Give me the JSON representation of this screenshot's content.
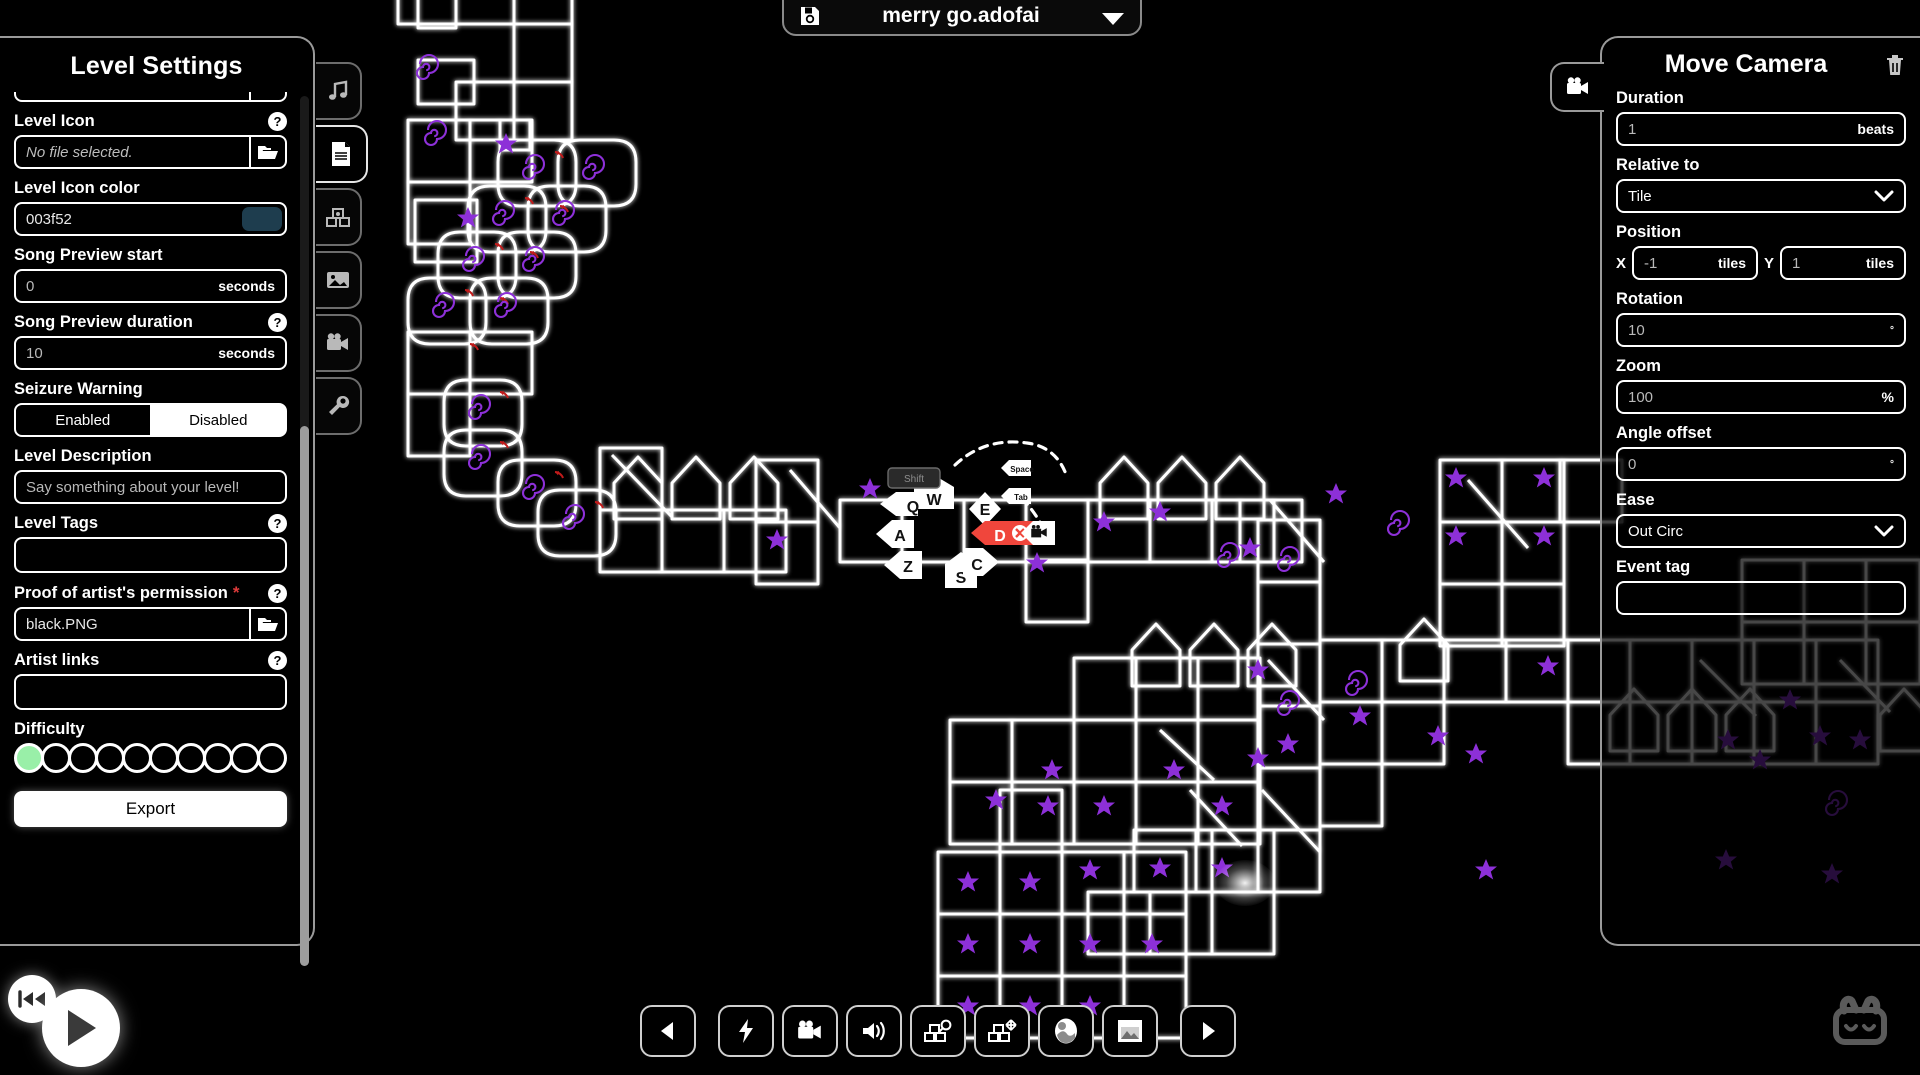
{
  "song_bar": {
    "save_icon": "floppy-disk-icon",
    "title": "merry go.adofai",
    "dropdown_icon": "chevron-down-icon"
  },
  "level_settings": {
    "title": "Level Settings",
    "fields": [
      {
        "label": "Level Icon",
        "help": "?",
        "value": "No file selected.",
        "placeholder": true,
        "control": "file",
        "icon": "folder-icon"
      },
      {
        "label": "Level Icon color",
        "value": "003f52",
        "control": "color",
        "swatch_hex": "#1e3d4e"
      },
      {
        "label": "Song Preview start",
        "value": "0",
        "unit": "seconds",
        "control": "number"
      },
      {
        "label": "Song Preview duration",
        "help": "?",
        "value": "10",
        "unit": "seconds",
        "control": "number"
      }
    ],
    "seizure_warning": {
      "label": "Seizure Warning",
      "options": [
        "Enabled",
        "Disabled"
      ],
      "selected": "Disabled"
    },
    "level_description": {
      "label": "Level Description",
      "placeholder": "Say something about your level!",
      "value": ""
    },
    "level_tags": {
      "label": "Level Tags",
      "help": "?",
      "value": ""
    },
    "proof": {
      "label": "Proof of artist's permission",
      "required_marker": "*",
      "help": "?",
      "value": "black.PNG",
      "icon": "folder-icon"
    },
    "artist_links": {
      "label": "Artist links",
      "help": "?",
      "value": ""
    },
    "difficulty": {
      "label": "Difficulty",
      "total": 10,
      "selected": 1,
      "fill_hex": "#99efa8"
    },
    "export_label": "Export"
  },
  "rail": {
    "items": [
      {
        "icon": "music-note-icon",
        "active": false
      },
      {
        "icon": "document-icon",
        "active": true
      },
      {
        "icon": "tiles-icon",
        "active": false
      },
      {
        "icon": "image-icon",
        "active": false
      },
      {
        "icon": "movie-camera-icon",
        "active": false
      },
      {
        "icon": "wrench-icon",
        "active": false
      }
    ]
  },
  "move_camera": {
    "title": "Move Camera",
    "delete_icon": "trash-icon",
    "tab_icon": "movie-camera-icon",
    "duration": {
      "label": "Duration",
      "value": "1",
      "unit": "beats"
    },
    "relative_to": {
      "label": "Relative to",
      "value": "Tile",
      "chevron": "chevron-down-icon"
    },
    "position": {
      "label": "Position",
      "x_axis": "X",
      "x_value": "-1",
      "x_unit": "tiles",
      "y_axis": "Y",
      "y_value": "1",
      "y_unit": "tiles"
    },
    "rotation": {
      "label": "Rotation",
      "value": "10",
      "unit": "°"
    },
    "zoom": {
      "label": "Zoom",
      "value": "100",
      "unit": "%"
    },
    "angle_offset": {
      "label": "Angle offset",
      "value": "0",
      "unit": "°"
    },
    "ease": {
      "label": "Ease",
      "value": "Out Circ",
      "chevron": "chevron-down-icon"
    },
    "event_tag": {
      "label": "Event tag",
      "value": ""
    }
  },
  "transport": {
    "rewind_icon": "rewind-icon",
    "play_icon": "play-icon"
  },
  "toolbar": {
    "items": [
      {
        "icon": "prev-arrow-icon",
        "name": "previous-button"
      },
      {
        "icon": "lightning-icon",
        "name": "effects-button"
      },
      {
        "icon": "movie-camera-icon",
        "name": "camera-button"
      },
      {
        "icon": "speaker-icon",
        "name": "sound-button"
      },
      {
        "icon": "tiles-key-icon",
        "name": "track-keys-button"
      },
      {
        "icon": "tiles-move-icon",
        "name": "track-move-button"
      },
      {
        "icon": "ellipse-icon",
        "name": "decoration-button"
      },
      {
        "icon": "image-icon",
        "name": "background-button"
      },
      {
        "icon": "next-arrow-icon",
        "name": "next-button"
      }
    ]
  },
  "mascot": {
    "icon": "robot-face-icon"
  },
  "level_canvas": {
    "key_markers": [
      {
        "label": "Q",
        "shape": "pentagon-left"
      },
      {
        "label": "W",
        "shape": "pentagon-up"
      },
      {
        "label": "E",
        "shape": "diamond"
      },
      {
        "label": "A",
        "shape": "pentagon-left"
      },
      {
        "label": "S",
        "shape": "pentagon-up"
      },
      {
        "label": "D",
        "shape": "pentagon-right",
        "selected": true,
        "close_icon": "close-circle-icon"
      },
      {
        "label": "Z",
        "shape": "pentagon-left"
      },
      {
        "label": "C",
        "shape": "pentagon-right"
      }
    ],
    "badges": [
      "Shift",
      "Space",
      "Tab"
    ],
    "selected_color_hex": "#f0463c",
    "tile_outline_hex": "#ffffff",
    "star_hex": "#8d30d8",
    "arrow_hex": "#c01b1b"
  }
}
